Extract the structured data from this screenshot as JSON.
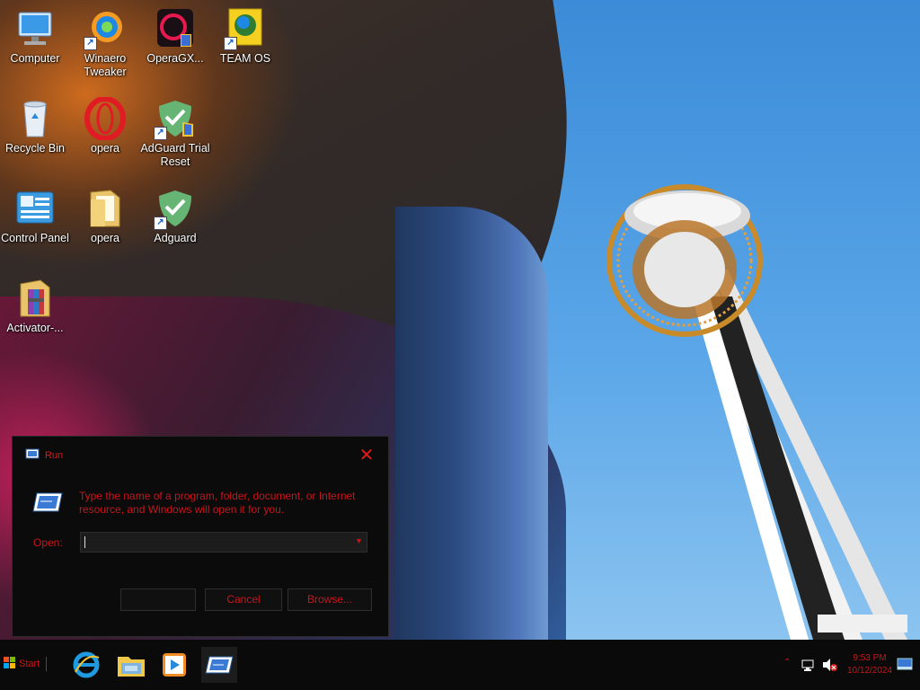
{
  "desktop_icons": [
    {
      "label": "Computer",
      "icon": "computer-icon"
    },
    {
      "label": "Winaero Tweaker",
      "icon": "winaero-tweaker-icon"
    },
    {
      "label": "OperaGX...",
      "icon": "opera-gx-icon"
    },
    {
      "label": "TEAM OS",
      "icon": "team-os-icon"
    },
    {
      "label": "Recycle Bin",
      "icon": "recycle-bin-icon"
    },
    {
      "label": "opera",
      "icon": "opera-icon"
    },
    {
      "label": "AdGuard Trial Reset",
      "icon": "adguard-trial-reset-icon"
    },
    {
      "label": "Control Panel",
      "icon": "control-panel-icon"
    },
    {
      "label": "opera",
      "icon": "folder-icon"
    },
    {
      "label": "Adguard",
      "icon": "adguard-icon"
    },
    {
      "label": "Activator-...",
      "icon": "winrar-archive-icon"
    }
  ],
  "run_dialog": {
    "title": "Run",
    "message": "Type the name of a program, folder, document, or Internet resource, and Windows will open it for you.",
    "open_label": "Open:",
    "open_value": "",
    "ok_label": "",
    "cancel_label": "Cancel",
    "browse_label": "Browse..."
  },
  "taskbar": {
    "start_label": "Start",
    "pinned": [
      "internet-explorer-icon",
      "file-explorer-icon",
      "media-player-icon",
      "run-icon"
    ],
    "clock_time": "9:53 PM",
    "clock_date": "10/12/2024",
    "tray_icons": [
      "show-hidden-icons-chevron",
      "network-icon",
      "volume-muted-icon",
      "show-desktop-icon"
    ]
  },
  "colors": {
    "accent_red": "#c8151b",
    "dialog_bg": "#0b0b0b",
    "taskbar_bg": "#0a0a0a"
  }
}
